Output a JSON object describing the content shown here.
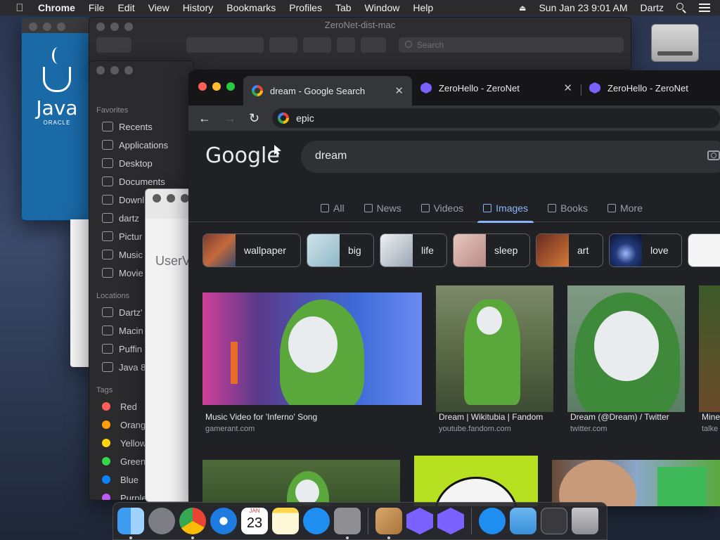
{
  "menubar": {
    "app": "Chrome",
    "items": [
      "File",
      "Edit",
      "View",
      "History",
      "Bookmarks",
      "Profiles",
      "Tab",
      "Window",
      "Help"
    ],
    "clock": "Sun Jan 23  9:01 AM",
    "user": "Dartz"
  },
  "java_window": {
    "logo_text": "Java",
    "logo_sub": "ORACLE"
  },
  "finder_back": {
    "title": "ZeroNet-dist-mac",
    "search_placeholder": "Search"
  },
  "finder_sidebar": {
    "favorites_header": "Favorites",
    "favorites": [
      "Recents",
      "Applications",
      "Desktop",
      "Documents",
      "Downl",
      "dartz",
      "Pictur",
      "Music",
      "Movie"
    ],
    "locations_header": "Locations",
    "locations": [
      "Dartz'",
      "Macin",
      "Puffin",
      "Java 8"
    ],
    "tags_header": "Tags",
    "tags": [
      {
        "label": "Red",
        "color": "#ff5f57"
      },
      {
        "label": "Orang",
        "color": "#ff9f0a"
      },
      {
        "label": "Yellow",
        "color": "#ffd60a"
      },
      {
        "label": "Green",
        "color": "#32d74b"
      },
      {
        "label": "Blue",
        "color": "#0a84ff"
      },
      {
        "label": "Purple",
        "color": "#bf5af2"
      }
    ]
  },
  "userv_window": {
    "label": "UserV"
  },
  "chrome": {
    "tabs": [
      {
        "title": "dream - Google Search",
        "active": true
      },
      {
        "title": "ZeroHello - ZeroNet",
        "active": false
      },
      {
        "title": "ZeroHello - ZeroNet",
        "active": false
      }
    ],
    "address": "epic",
    "google_logo": "Google",
    "search_query": "dream",
    "nav_tabs": [
      {
        "label": "All",
        "active": false
      },
      {
        "label": "News",
        "active": false
      },
      {
        "label": "Videos",
        "active": false
      },
      {
        "label": "Images",
        "active": true
      },
      {
        "label": "Books",
        "active": false
      },
      {
        "label": "More",
        "active": false
      }
    ],
    "chips": [
      "wallpaper",
      "big",
      "life",
      "sleep",
      "art",
      "love"
    ],
    "results": [
      {
        "caption": "Music Video for 'Inferno' Song",
        "source": "gamerant.com"
      },
      {
        "caption": "Dream | Wikitubia | Fandom",
        "source": "youtube.fandom.com"
      },
      {
        "caption": "Dream (@Dream) / Twitter",
        "source": "twitter.com"
      },
      {
        "caption": "Mine",
        "source": "talke"
      }
    ]
  },
  "dock": {
    "apps": [
      "finder-icon",
      "launchpad-icon",
      "chrome-icon",
      "safari-icon",
      "calendar-icon",
      "notes-icon",
      "app-store-icon",
      "system-preferences-icon",
      "installer-icon",
      "zeronet-icon",
      "zeronet-icon",
      "app-store-icon",
      "downloads-folder-icon",
      "screenshot-icon",
      "trash-icon"
    ],
    "calendar_month": "JAN",
    "calendar_day": "23"
  },
  "colors": {
    "accent": "#8ab4f8",
    "chrome_bg": "#202124",
    "menubar_bg": "#2b2b2d"
  }
}
